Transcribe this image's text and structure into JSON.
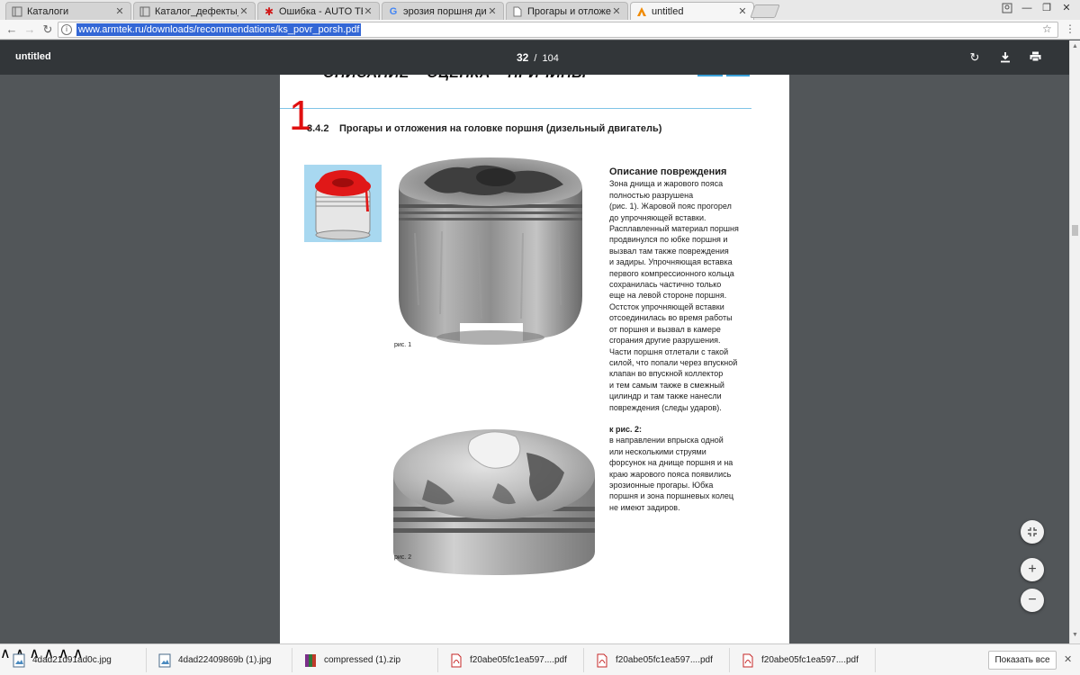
{
  "tabs": [
    {
      "title": "Каталоги",
      "icon": "catalog-icon",
      "active": false
    },
    {
      "title": "Каталог_дефекты_в_печ",
      "icon": "catalog-icon",
      "active": false
    },
    {
      "title": "Ошибка - AUTO TECHNI",
      "icon": "gear-red-icon",
      "active": false
    },
    {
      "title": "эрозия поршня дизель",
      "icon": "google-icon",
      "active": false
    },
    {
      "title": "Прогары и отложения в",
      "icon": "document-icon",
      "active": false
    },
    {
      "title": "untitled",
      "icon": "armtek-icon",
      "active": true
    }
  ],
  "toolbar": {
    "url": "www.armtek.ru/downloads/recommendations/ks_povr_porsh.pdf"
  },
  "pdf": {
    "title": "untitled",
    "current_page": "32",
    "separator": "/",
    "total_pages": "104"
  },
  "page": {
    "heading_partial": "ОПИСАНИЕ – ОЦЕНКА – ПРИЧИНЫ",
    "annotation_number": "1",
    "section_number": "3.4.2",
    "section_title": "Прогары и отложения на головке поршня (дизельный двигатель)",
    "fig1_label": "рис. 1",
    "fig2_label": "рис. 2",
    "description_heading": "Описание повреждения",
    "description_lines": [
      "Зона днища и жарового пояса",
      "полностью разрушена",
      "(рис. 1). Жаровой пояс прогорел",
      "до упрочняющей вставки.",
      "Расплавленный материал поршня",
      "продвинулся по юбке поршня и",
      "вызвал там также повреждения",
      "и задиры. Упрочняющая вставка",
      "первого компрессионного кольца",
      "сохранилась частично только",
      "еще на левой стороне поршня.",
      "Остсток упрочняющей вставки",
      "отсоединилась во время работы",
      "от поршня и вызвал в камере",
      "сгорания другие разрушения.",
      "Части поршня отлетали с такой",
      "силой, что попали через впускной",
      "клапан во впускной коллектор",
      "и тем самым также в смежный",
      "цилиндр и там также нанесли",
      "повреждения (следы ударов)."
    ],
    "fig2_heading": "к рис. 2:",
    "fig2_lines": [
      "в направлении впрыска одной",
      "или несколькими струями",
      "форсунок на днище поршня и на",
      "краю жарового пояса появились",
      "эрозионные прогары. Юбка",
      "поршня и зона поршневых колец",
      "не имеют задиров."
    ]
  },
  "downloads": [
    {
      "name": "4dad21d91ad0c.jpg",
      "icon": "image-file-icon"
    },
    {
      "name": "4dad22409869b (1).jpg",
      "icon": "image-file-icon"
    },
    {
      "name": "compressed (1).zip",
      "icon": "zip-file-icon"
    },
    {
      "name": "f20abe05fc1ea597....pdf",
      "icon": "pdf-file-icon"
    },
    {
      "name": "f20abe05fc1ea597....pdf",
      "icon": "pdf-file-icon"
    },
    {
      "name": "f20abe05fc1ea597....pdf",
      "icon": "pdf-file-icon"
    }
  ],
  "show_all_label": "Показать все",
  "colors": {
    "pdf_toolbar": "#323639",
    "viewer_bg": "#525659",
    "url_highlight": "#3367d6",
    "annotation_red": "#e01010",
    "thumb_bg": "#a8d8f0"
  }
}
